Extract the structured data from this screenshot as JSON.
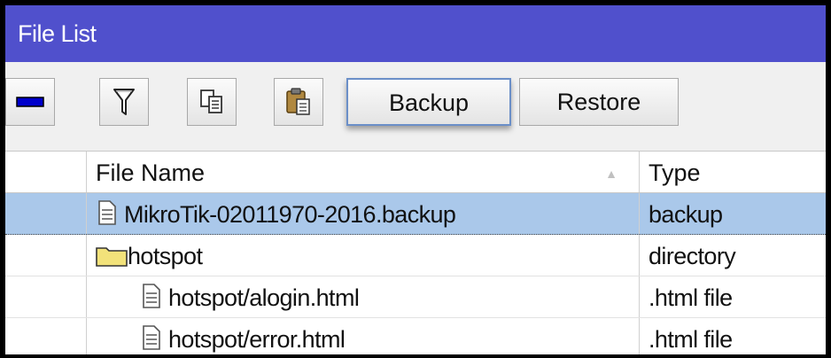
{
  "window": {
    "title": "File List"
  },
  "toolbar": {
    "remove_icon": "minus-icon",
    "filter_icon": "filter-icon",
    "copy_icon": "copy-icon",
    "paste_icon": "paste-icon",
    "backup_label": "Backup",
    "restore_label": "Restore"
  },
  "table": {
    "columns": [
      "File Name",
      "Type"
    ],
    "rows": [
      {
        "name": "MikroTik-02011970-2016.backup",
        "type": "backup",
        "icon": "file-icon",
        "selected": true
      },
      {
        "name": "hotspot",
        "type": "directory",
        "icon": "folder-icon",
        "selected": false
      },
      {
        "name": "hotspot/alogin.html",
        "type": ".html file",
        "icon": "file-icon",
        "selected": false
      },
      {
        "name": "hotspot/error.html",
        "type": ".html file",
        "icon": "file-icon",
        "selected": false
      }
    ]
  },
  "colors": {
    "titlebar": "#5050cc",
    "selection": "#aac8ea",
    "minus": "#0000cc"
  }
}
